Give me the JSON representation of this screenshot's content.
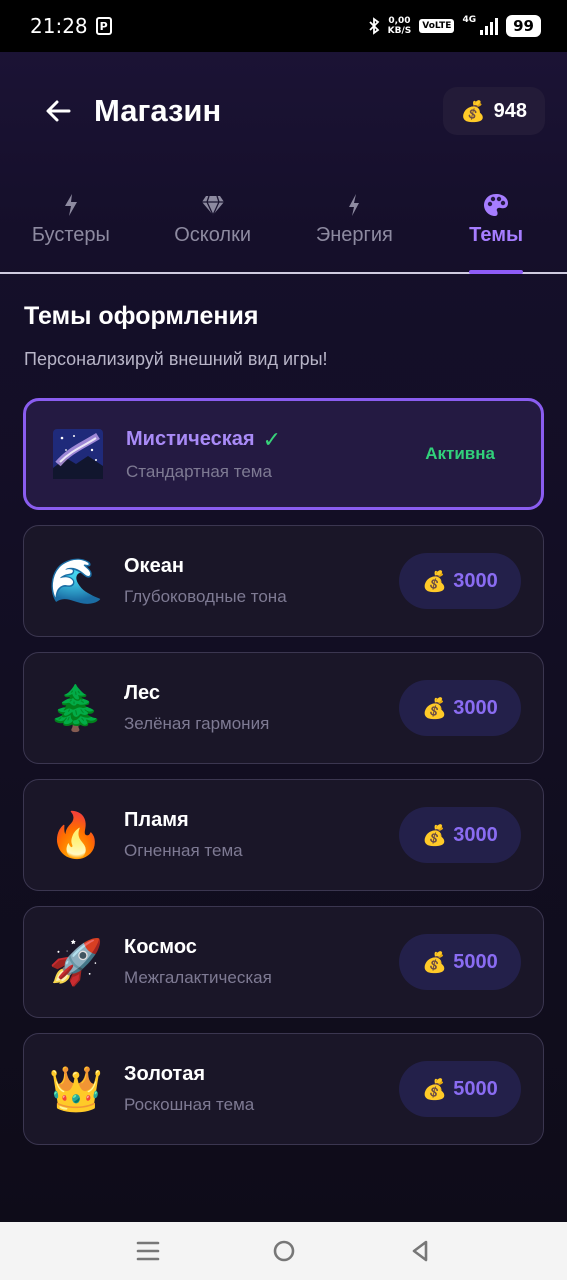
{
  "status_bar": {
    "time": "21:28",
    "notification_icon": "p-icon",
    "net_speed_value": "0,00",
    "net_speed_unit": "KB/S",
    "volte": "VoLTE",
    "network": "4G",
    "battery": "99"
  },
  "header": {
    "title": "Магазин",
    "back_icon": "back-arrow-icon",
    "balance_icon": "money-bag-icon",
    "balance": "948"
  },
  "tabs": [
    {
      "label": "Бустеры",
      "icon": "bolt-icon",
      "active": false
    },
    {
      "label": "Осколки",
      "icon": "gem-icon",
      "active": false
    },
    {
      "label": "Энергия",
      "icon": "lightning-icon",
      "active": false
    },
    {
      "label": "Темы",
      "icon": "palette-icon",
      "active": true
    }
  ],
  "section": {
    "title": "Темы оформления",
    "subtitle": "Персонализируй внешний вид игры!"
  },
  "themes": [
    {
      "name": "Мистическая",
      "desc": "Стандартная тема",
      "icon": "milky-way-icon",
      "status": "Активна",
      "active": true,
      "check": "✓"
    },
    {
      "name": "Океан",
      "desc": "Глубоководные тона",
      "icon": "wave-icon",
      "emoji": "🌊",
      "price": "3000"
    },
    {
      "name": "Лес",
      "desc": "Зелёная гармония",
      "icon": "tree-icon",
      "emoji": "🌲",
      "price": "3000"
    },
    {
      "name": "Пламя",
      "desc": "Огненная тема",
      "icon": "fire-icon",
      "emoji": "🔥",
      "price": "3000"
    },
    {
      "name": "Космос",
      "desc": "Межгалактическая",
      "icon": "rocket-icon",
      "emoji": "🚀",
      "price": "5000"
    },
    {
      "name": "Золотая",
      "desc": "Роскошная тема",
      "icon": "crown-icon",
      "emoji": "👑",
      "price": "5000"
    }
  ],
  "money_emoji": "💰",
  "colors": {
    "accent": "#8e5cf7",
    "active_green": "#31d07a",
    "card_bg": "#1a1628"
  },
  "nav_bar": {
    "menu_icon": "menu-icon",
    "home_icon": "home-circle-icon",
    "back_icon": "back-triangle-icon"
  }
}
